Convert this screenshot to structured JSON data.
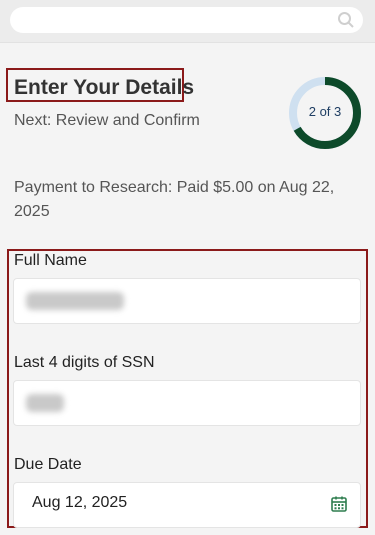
{
  "search": {
    "placeholder": ""
  },
  "header": {
    "title": "Enter Your Details",
    "next_step": "Next: Review and Confirm"
  },
  "progress": {
    "label": "2 of 3",
    "current": 2,
    "total": 3
  },
  "payment_note": "Payment to Research: Paid $5.00 on Aug 22, 2025",
  "form": {
    "full_name": {
      "label": "Full Name",
      "value": ""
    },
    "ssn_last4": {
      "label": "Last 4 digits of SSN",
      "value": ""
    },
    "due_date": {
      "label": "Due Date",
      "value": "Aug 12, 2025"
    }
  },
  "colors": {
    "accent_green": "#0d4a2a",
    "progress_track": "#cfe0f0",
    "highlight_border": "#8b1a1a"
  },
  "icons": {
    "search": "search-icon",
    "calendar": "calendar-icon"
  }
}
